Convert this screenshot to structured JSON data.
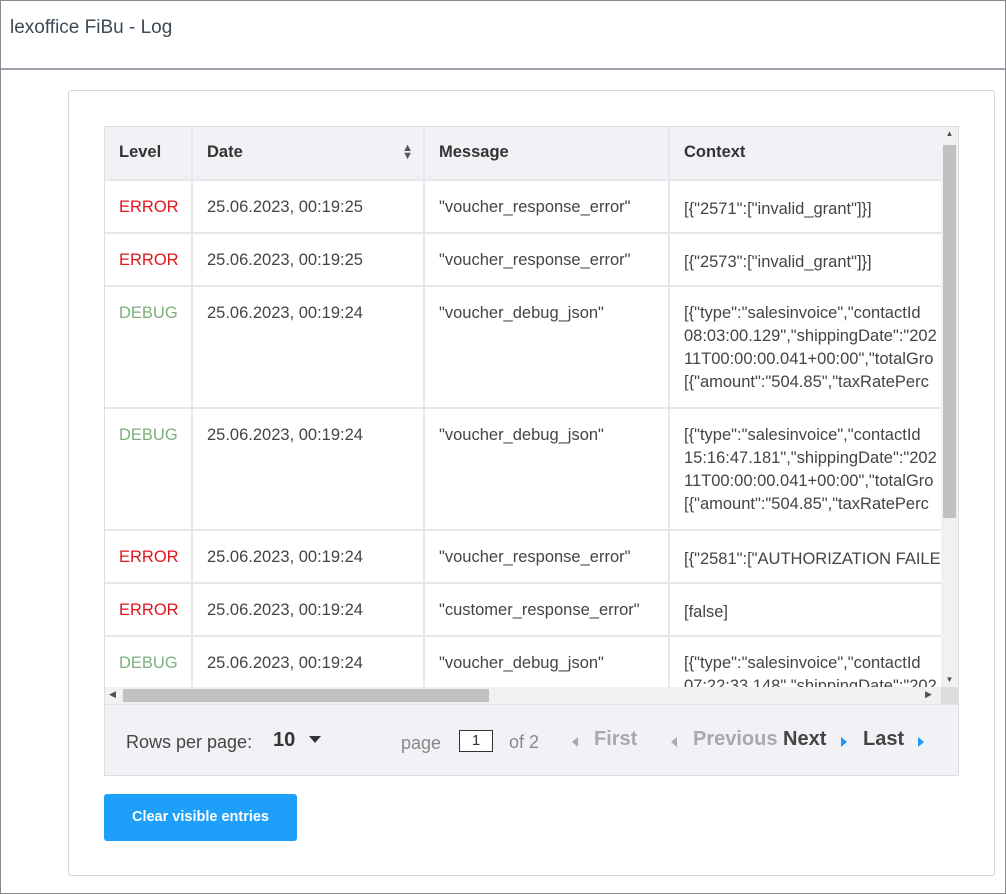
{
  "header": {
    "title": "lexoffice FiBu - Log"
  },
  "table": {
    "columns": [
      "Level",
      "Date",
      "Message",
      "Context"
    ],
    "rows": [
      {
        "level": "ERROR",
        "date": "25.06.2023, 00:19:25",
        "message": "\"voucher_response_error\"",
        "context": [
          "[{\"2571\":[\"invalid_grant\"]}]"
        ]
      },
      {
        "level": "ERROR",
        "date": "25.06.2023, 00:19:25",
        "message": "\"voucher_response_error\"",
        "context": [
          "[{\"2573\":[\"invalid_grant\"]}]"
        ]
      },
      {
        "level": "DEBUG",
        "date": "25.06.2023, 00:19:24",
        "message": "\"voucher_debug_json\"",
        "context": [
          "[{\"type\":\"salesinvoice\",\"contactId",
          "08:03:00.129\",\"shippingDate\":\"202",
          "11T00:00:00.041+00:00\",\"totalGro",
          "[{\"amount\":\"504.85\",\"taxRatePerc"
        ]
      },
      {
        "level": "DEBUG",
        "date": "25.06.2023, 00:19:24",
        "message": "\"voucher_debug_json\"",
        "context": [
          "[{\"type\":\"salesinvoice\",\"contactId",
          "15:16:47.181\",\"shippingDate\":\"202",
          "11T00:00:00.041+00:00\",\"totalGro",
          "[{\"amount\":\"504.85\",\"taxRatePerc"
        ]
      },
      {
        "level": "ERROR",
        "date": "25.06.2023, 00:19:24",
        "message": "\"voucher_response_error\"",
        "context": [
          "[{\"2581\":[\"AUTHORIZATION FAILE"
        ]
      },
      {
        "level": "ERROR",
        "date": "25.06.2023, 00:19:24",
        "message": "\"customer_response_error\"",
        "context": [
          "[false]"
        ]
      },
      {
        "level": "DEBUG",
        "date": "25.06.2023, 00:19:24",
        "message": "\"voucher_debug_json\"",
        "context": [
          "[{\"type\":\"salesinvoice\",\"contactId",
          "07:22:33.148\",\"shippingDate\":\"202"
        ]
      }
    ]
  },
  "pagination": {
    "rows_per_page_label": "Rows per page:",
    "rows_per_page_value": "10",
    "page_label": "page",
    "current_page": "1",
    "of_label": "of 2",
    "first": "First",
    "previous": "Previous",
    "next": "Next",
    "last": "Last"
  },
  "actions": {
    "clear_label": "Clear visible entries"
  },
  "colors": {
    "error": "#e0161f",
    "debug": "#7cb07c",
    "accent": "#1ea0fa"
  }
}
